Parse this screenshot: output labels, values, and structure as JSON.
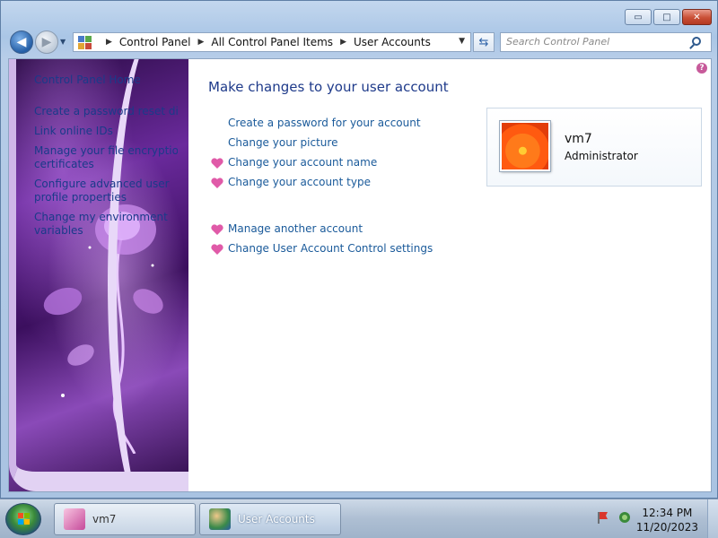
{
  "window": {
    "caption_buttons": {
      "minimize": "▭",
      "maximize": "□",
      "close": "✕"
    }
  },
  "nav": {
    "back_icon": "◀",
    "forward_icon": "▶",
    "dropdown_icon": "▼",
    "breadcrumb": [
      "Control Panel",
      "All Control Panel Items",
      "User Accounts"
    ],
    "breadcrumb_sep": "▶",
    "refresh_icon": "⇆",
    "search_placeholder": "Search Control Panel"
  },
  "sidebar": {
    "home": "Control Panel Home",
    "links": [
      "Create a password reset disk",
      "Link online IDs",
      "Manage your file encryption",
      "certificates",
      "Configure advanced user",
      "profile properties",
      "Change my environment",
      "variables"
    ]
  },
  "main": {
    "help": "?",
    "title": "Make changes to your user account",
    "tasks": [
      {
        "label": "Create a password for your account",
        "icon": false
      },
      {
        "label": "Change your picture",
        "icon": false
      },
      {
        "label": "Change your account name",
        "icon": true
      },
      {
        "label": "Change your account type",
        "icon": true
      }
    ],
    "tasks2": [
      {
        "label": "Manage another account",
        "icon": true
      },
      {
        "label": "Change User Account Control settings",
        "icon": true
      }
    ],
    "account": {
      "name": "vm7",
      "role": "Administrator"
    }
  },
  "taskbar": {
    "buttons": [
      {
        "label": "vm7"
      },
      {
        "label": "User Accounts"
      }
    ],
    "time": "12:34 PM",
    "date": "11/20/2023"
  },
  "colors": {
    "link": "#1a5a9a",
    "title": "#1e3a8a",
    "heart": "#e05aa8"
  }
}
